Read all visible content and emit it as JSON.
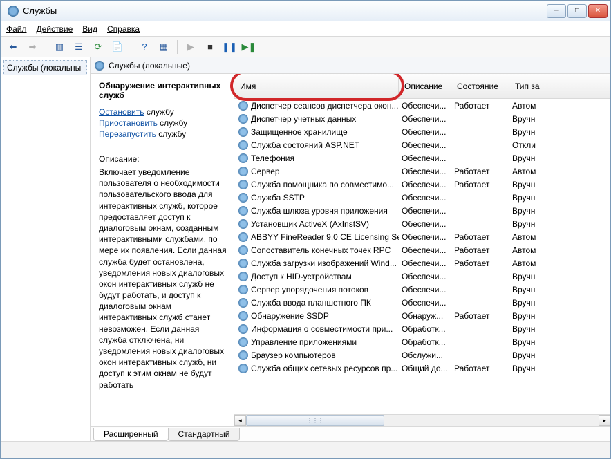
{
  "window": {
    "title": "Службы"
  },
  "menu": {
    "file": "Файл",
    "action": "Действие",
    "view": "Вид",
    "help": "Справка"
  },
  "tree": {
    "root": "Службы (локальны"
  },
  "header": {
    "title": "Службы (локальные)"
  },
  "detail": {
    "title": "Обнаружение интерактивных служб",
    "stop_link": "Остановить",
    "stop_suffix": " службу",
    "pause_link": "Приостановить",
    "pause_suffix": " службу",
    "restart_link": "Перезапустить",
    "restart_suffix": " службу",
    "desc_label": "Описание:",
    "desc_text": "Включает уведомление пользователя о необходимости пользовательского ввода для интерактивных служб, которое предоставляет доступ к диалоговым окнам, созданным интерактивными службами, по мере их появления. Если данная служба будет остановлена, уведомления новых диалоговых окон интерактивных служб не будут работать, и доступ к диалоговым окнам интерактивных служб станет невозможен. Если данная служба отключена, ни уведомления новых диалоговых окон интерактивных служб, ни доступ к этим окнам не будут работать"
  },
  "columns": {
    "name": "Имя",
    "desc": "Описание",
    "state": "Состояние",
    "type": "Тип за"
  },
  "services": [
    {
      "name": "Диспетчер сеансов диспетчера окон...",
      "desc": "Обеспечи...",
      "state": "Работает",
      "type": "Автом"
    },
    {
      "name": "Диспетчер учетных данных",
      "desc": "Обеспечи...",
      "state": "",
      "type": "Вручн"
    },
    {
      "name": "Защищенное хранилище",
      "desc": "Обеспечи...",
      "state": "",
      "type": "Вручн"
    },
    {
      "name": "Служба состояний ASP.NET",
      "desc": "Обеспечи...",
      "state": "",
      "type": "Откли"
    },
    {
      "name": "Телефония",
      "desc": "Обеспечи...",
      "state": "",
      "type": "Вручн"
    },
    {
      "name": "Сервер",
      "desc": "Обеспечи...",
      "state": "Работает",
      "type": "Автом"
    },
    {
      "name": "Служба помощника по совместимо...",
      "desc": "Обеспечи...",
      "state": "Работает",
      "type": "Вручн"
    },
    {
      "name": "Служба SSTP",
      "desc": "Обеспечи...",
      "state": "",
      "type": "Вручн"
    },
    {
      "name": "Служба шлюза уровня приложения",
      "desc": "Обеспечи...",
      "state": "",
      "type": "Вручн"
    },
    {
      "name": "Установщик ActiveX (AxInstSV)",
      "desc": "Обеспечи...",
      "state": "",
      "type": "Вручн"
    },
    {
      "name": "ABBYY FineReader 9.0 CE Licensing Se...",
      "desc": "Обеспечи...",
      "state": "Работает",
      "type": "Автом"
    },
    {
      "name": "Сопоставитель конечных точек RPC",
      "desc": "Обеспечи...",
      "state": "Работает",
      "type": "Автом"
    },
    {
      "name": "Служба загрузки изображений Wind...",
      "desc": "Обеспечи...",
      "state": "Работает",
      "type": "Автом"
    },
    {
      "name": "Доступ к HID-устройствам",
      "desc": "Обеспечи...",
      "state": "",
      "type": "Вручн"
    },
    {
      "name": "Сервер упорядочения потоков",
      "desc": "Обеспечи...",
      "state": "",
      "type": "Вручн"
    },
    {
      "name": "Служба ввода планшетного ПК",
      "desc": "Обеспечи...",
      "state": "",
      "type": "Вручн"
    },
    {
      "name": "Обнаружение SSDP",
      "desc": "Обнаруж...",
      "state": "Работает",
      "type": "Вручн"
    },
    {
      "name": "Информация о совместимости при...",
      "desc": "Обработк...",
      "state": "",
      "type": "Вручн"
    },
    {
      "name": "Управление приложениями",
      "desc": "Обработк...",
      "state": "",
      "type": "Вручн"
    },
    {
      "name": "Браузер компьютеров",
      "desc": "Обслужи...",
      "state": "",
      "type": "Вручн"
    },
    {
      "name": "Служба общих сетевых ресурсов пр...",
      "desc": "Общий до...",
      "state": "Работает",
      "type": "Вручн"
    }
  ],
  "tabs": {
    "extended": "Расширенный",
    "standard": "Стандартный"
  }
}
